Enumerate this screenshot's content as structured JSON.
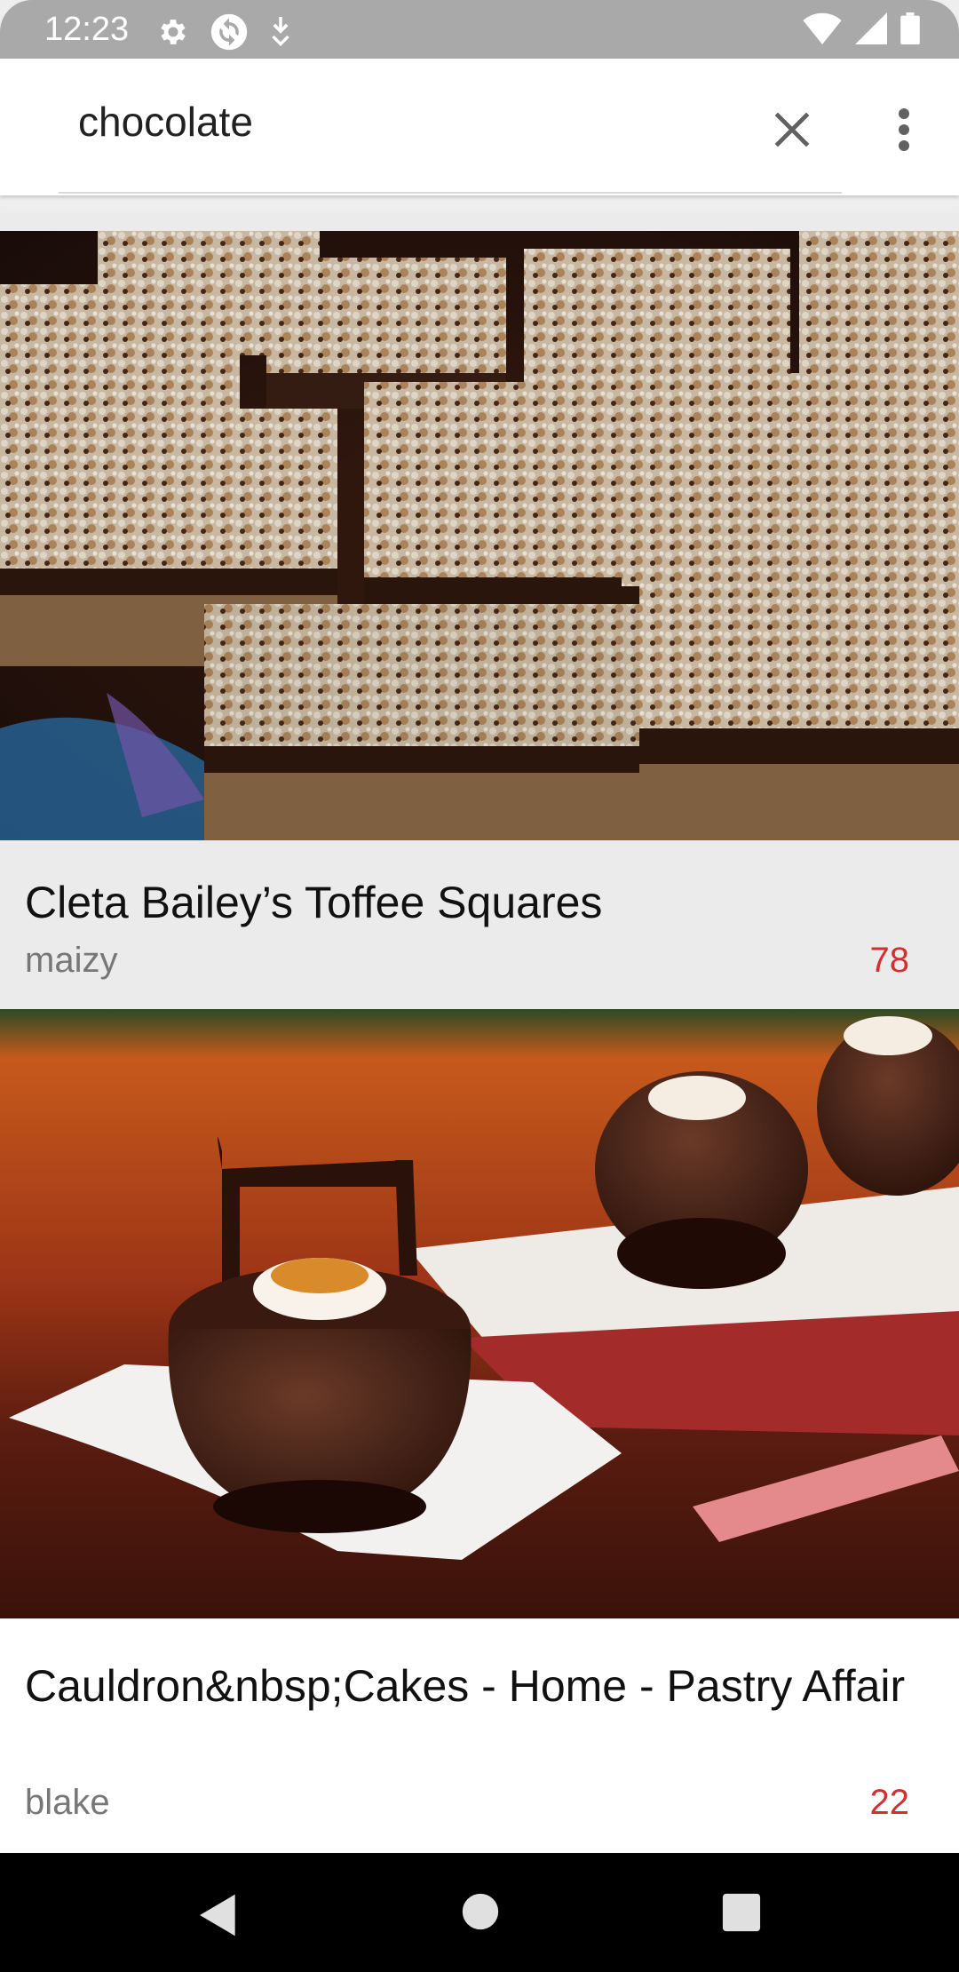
{
  "status_bar": {
    "time": "12:23",
    "icons_left": [
      "settings-icon",
      "sync-icon",
      "download-icon"
    ],
    "icons_right": [
      "wifi-icon",
      "signal-icon",
      "battery-icon"
    ]
  },
  "search": {
    "query": "chocolate",
    "clear_icon": "close-icon",
    "menu_icon": "more-vert-icon"
  },
  "results": [
    {
      "title": "Cleta Bailey’s Toffee Squares",
      "author": "maizy",
      "count": "78",
      "image": "toffee-squares-photo"
    },
    {
      "title": "Cauldron&nbsp;Cakes - Home - Pastry Affair",
      "author": "blake",
      "count": "22",
      "image": "cauldron-cakes-photo"
    }
  ],
  "colors": {
    "count_accent": "#d32f2f",
    "status_bar": "#a9a9a9",
    "nav_bar": "#000000"
  },
  "nav_bar": {
    "icons": [
      "back-icon",
      "home-icon",
      "recents-icon"
    ]
  }
}
